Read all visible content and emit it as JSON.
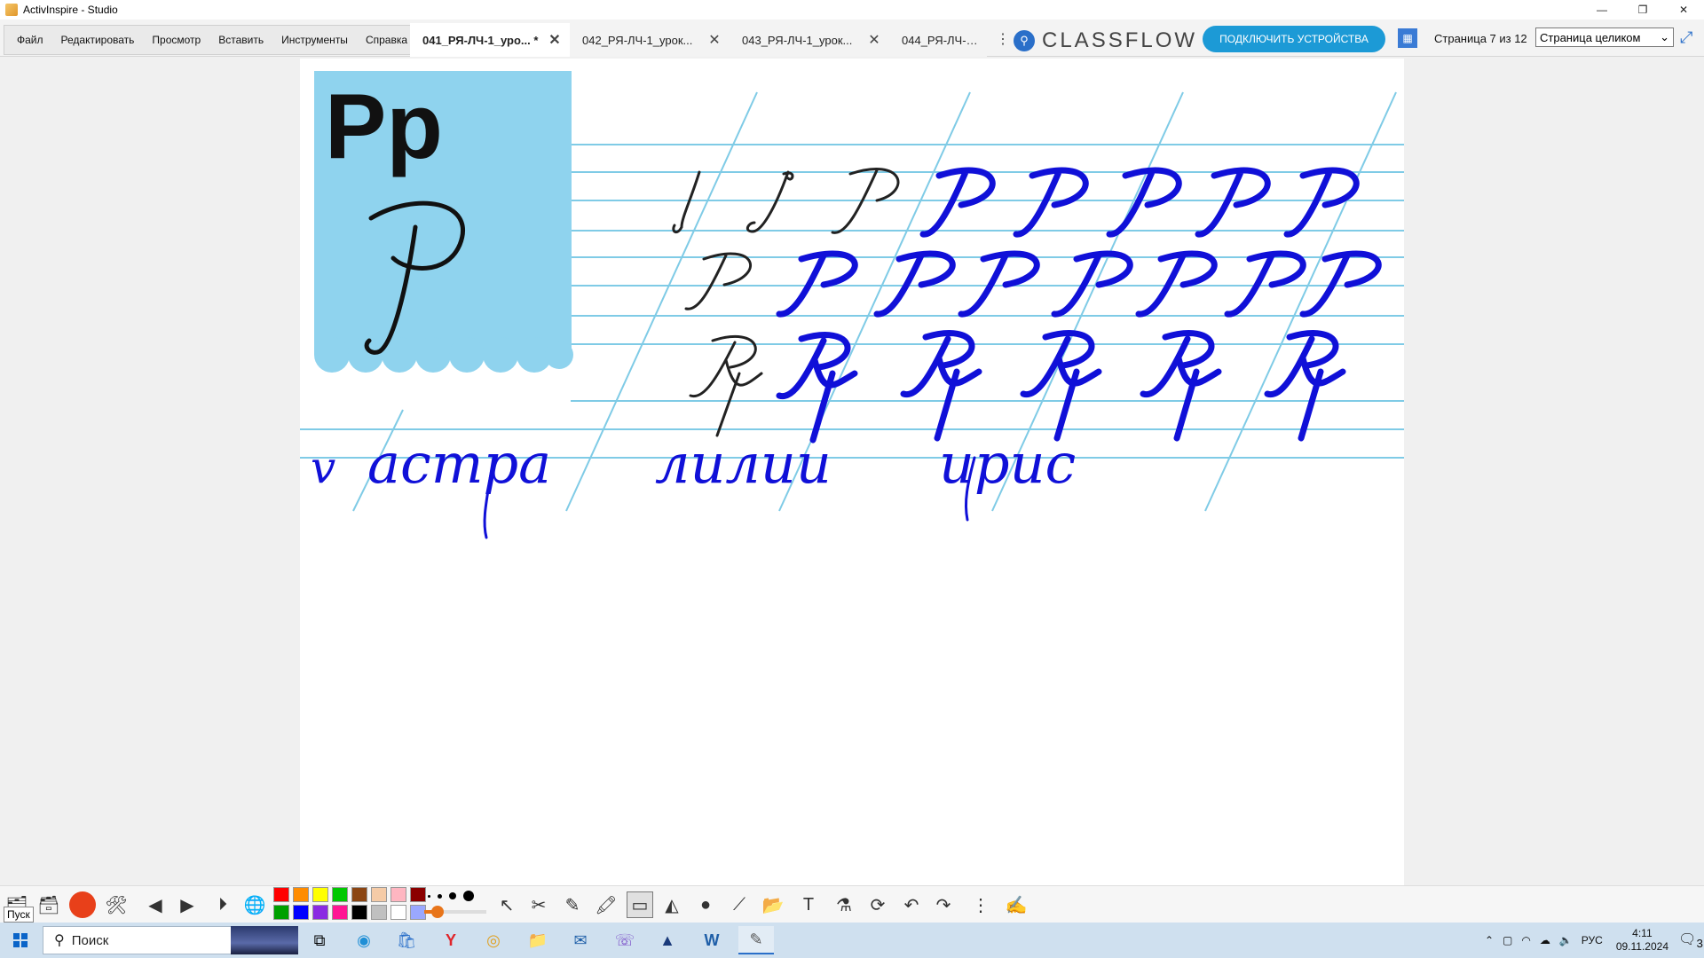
{
  "window": {
    "title": "ActivInspire - Studio",
    "minimize": "—",
    "maximize": "❐",
    "close": "✕"
  },
  "menu": [
    "Файл",
    "Редактировать",
    "Просмотр",
    "Вставить",
    "Инструменты",
    "Справка"
  ],
  "tabs": [
    {
      "label": "041_РЯ-ЛЧ-1_уро... *",
      "active": true
    },
    {
      "label": "042_РЯ-ЛЧ-1_урок...",
      "active": false
    },
    {
      "label": "043_РЯ-ЛЧ-1_урок...",
      "active": false
    },
    {
      "label": "044_РЯ-ЛЧ-1_уро",
      "active": false
    }
  ],
  "classflow": {
    "logo": "CLASSFLOW",
    "connect_button": "ПОДКЛЮЧИТЬ УСТРОЙСТВА"
  },
  "pagination": {
    "page_info": "Страница 7 из 12",
    "zoom": "Страница целиком"
  },
  "canvas": {
    "printed_letters": "Рр",
    "handwritten_words": [
      "v",
      "астра",
      "лилии",
      "ирис"
    ]
  },
  "toolbox": {
    "colors": [
      "#ff0000",
      "#ff8c00",
      "#ffff00",
      "#00c800",
      "#8b4513",
      "#f5cba7",
      "#ffb6c1",
      "#8b0000",
      "#00a000",
      "#0000ff",
      "#8a2be2",
      "#ff1493",
      "#000000",
      "#c0c0c0",
      "#ffffff",
      "#9aa8ff"
    ],
    "tooltip": "Пуск",
    "pen_width_fraction": 0.22
  },
  "taskbar": {
    "search_placeholder": "Поиск",
    "language": "РУС",
    "time": "4:11",
    "date": "09.11.2024",
    "notifications": "3"
  }
}
